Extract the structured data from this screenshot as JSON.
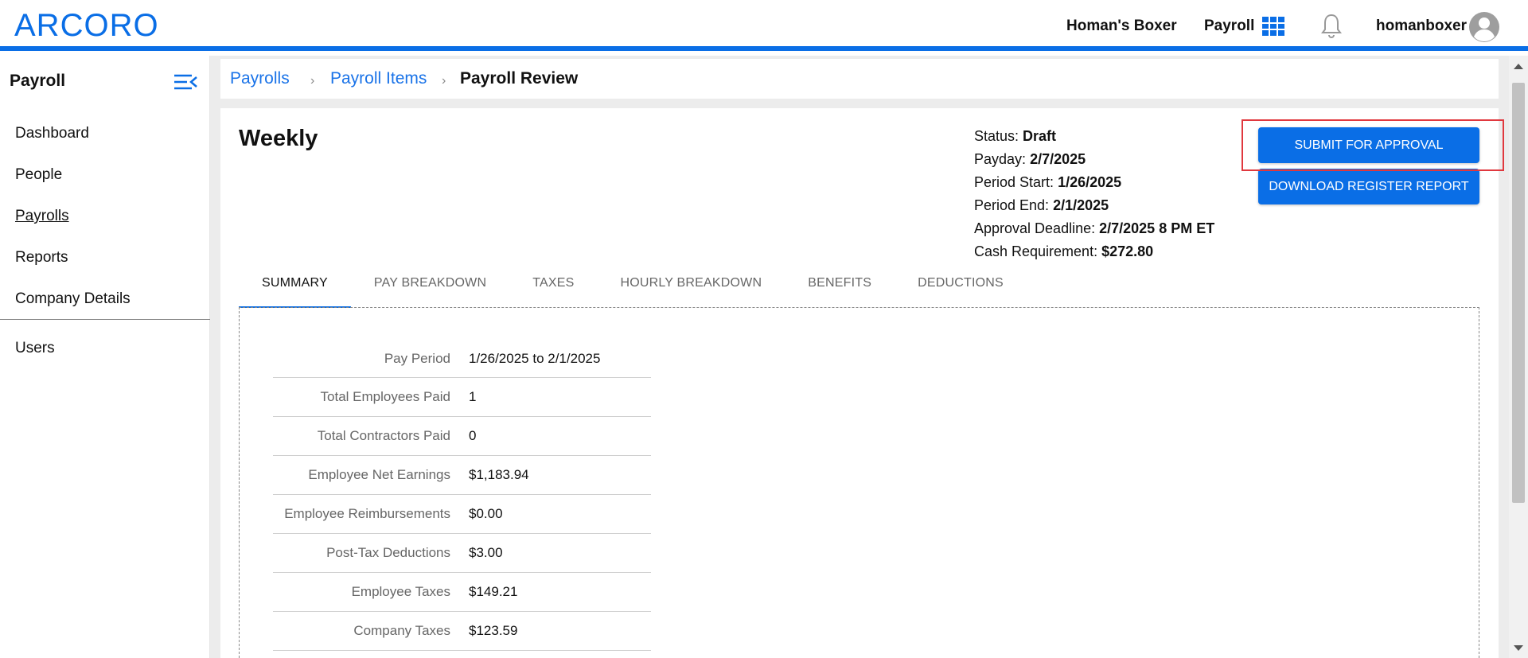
{
  "header": {
    "logo_text": "ARCORO",
    "company": "Homan's Boxer",
    "app_name": "Payroll",
    "username": "homanboxer",
    "accent_color": "#0a6ee6"
  },
  "sidebar": {
    "title": "Payroll",
    "items": [
      {
        "label": "Dashboard"
      },
      {
        "label": "People"
      },
      {
        "label": "Payrolls"
      },
      {
        "label": "Reports"
      },
      {
        "label": "Company Details"
      }
    ],
    "secondary_items": [
      {
        "label": "Users"
      }
    ],
    "active_item": "Payrolls"
  },
  "breadcrumb": {
    "items": [
      {
        "label": "Payrolls"
      },
      {
        "label": "Payroll Items"
      },
      {
        "label": "Payroll Review"
      }
    ],
    "separator": "›"
  },
  "page": {
    "title": "Weekly"
  },
  "meta": {
    "status_label": "Status:",
    "status_value": "Draft",
    "payday_label": "Payday:",
    "payday_value": "2/7/2025",
    "period_start_label": "Period Start:",
    "period_start_value": "1/26/2025",
    "period_end_label": "Period End:",
    "period_end_value": "2/1/2025",
    "approval_deadline_label": "Approval Deadline:",
    "approval_deadline_value": "2/7/2025 8 PM ET",
    "cash_requirement_label": "Cash Requirement:",
    "cash_requirement_value": "$272.80"
  },
  "actions": {
    "submit_label": "SUBMIT FOR APPROVAL",
    "download_label": "DOWNLOAD REGISTER REPORT"
  },
  "tabs": [
    {
      "label": "SUMMARY",
      "active": true
    },
    {
      "label": "PAY BREAKDOWN"
    },
    {
      "label": "TAXES"
    },
    {
      "label": "HOURLY BREAKDOWN"
    },
    {
      "label": "BENEFITS"
    },
    {
      "label": "DEDUCTIONS"
    }
  ],
  "summary": {
    "rows": [
      {
        "label": "Pay Period",
        "value": "1/26/2025 to 2/1/2025"
      },
      {
        "label": "Total Employees Paid",
        "value": "1"
      },
      {
        "label": "Total Contractors Paid",
        "value": "0"
      },
      {
        "label": "Employee Net Earnings",
        "value": "$1,183.94"
      },
      {
        "label": "Employee Reimbursements",
        "value": "$0.00"
      },
      {
        "label": "Post-Tax Deductions",
        "value": "$3.00"
      },
      {
        "label": "Employee Taxes",
        "value": "$149.21"
      },
      {
        "label": "Company Taxes",
        "value": "$123.59"
      }
    ]
  }
}
